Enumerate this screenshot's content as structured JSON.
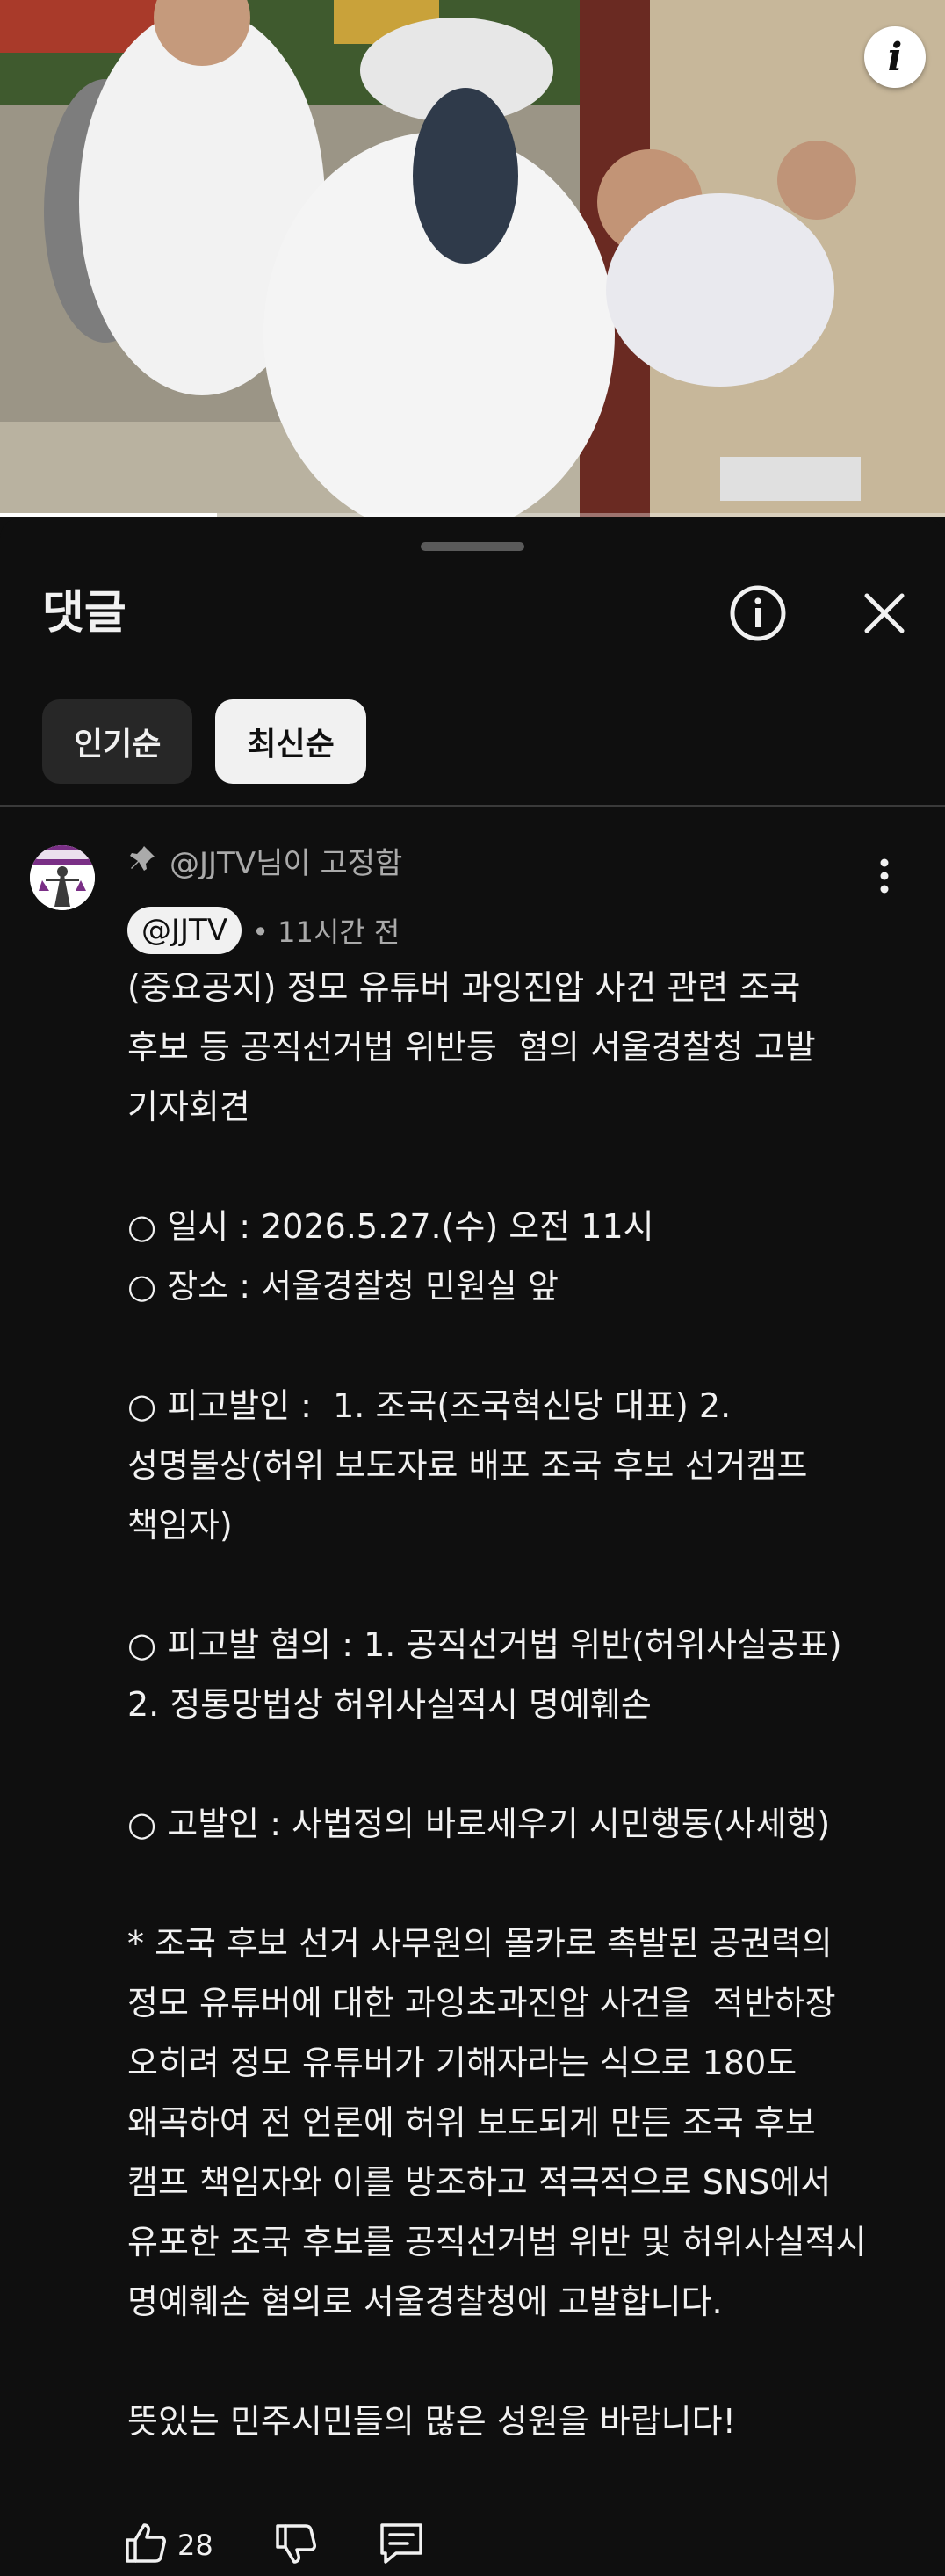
{
  "video": {
    "info_icon": "info-i-icon",
    "progress_fraction": 0.23
  },
  "sheet": {
    "title": "댓글",
    "info_icon": "info-circle-icon",
    "close_icon": "close-x-icon"
  },
  "sort_chips": [
    {
      "label": "인기순",
      "selected": false
    },
    {
      "label": "최신순",
      "selected": true
    }
  ],
  "comment": {
    "pinned_label": "@JJTV님이 고정함",
    "pin_icon": "pin-icon",
    "author": "@JJTV",
    "time": "• 11시간 전",
    "more_icon": "more-vertical-icon",
    "lines": [
      "(중요공지) 정모 유튜버 과잉진압 사건 관련 조국",
      "후보 등 공직선거법 위반등  혐의 서울경찰청 고발",
      "기자회견",
      "",
      "○ 일시 : 2026.5.27.(수) 오전 11시",
      "○ 장소 : 서울경찰청 민원실 앞",
      "",
      "○ 피고발인 :  1. 조국(조국혁신당 대표) 2.",
      "성명불상(허위 보도자료 배포 조국 후보 선거캠프",
      "책임자)",
      "",
      "○ 피고발 혐의 : 1. 공직선거법 위반(허위사실공표)",
      "2. 정통망법상 허위사실적시 명예훼손",
      "",
      "○ 고발인 : 사법정의 바로세우기 시민행동(사세행)",
      "",
      "* 조국 후보 선거 사무원의 몰카로 촉발된 공권력의",
      "정모 유튜버에 대한 과잉초과진압 사건을  적반하장",
      "오히려 정모 유튜버가 기해자라는 식으로 180도",
      "왜곡하여 전 언론에 허위 보도되게 만든 조국 후보",
      "캠프 책임자와 이를 방조하고 적극적으로 SNS에서",
      "유포한 조국 후보를 공직선거법 위반 및 허위사실적시",
      "명예훼손 혐의로 서울경찰청에 고발합니다.",
      "",
      "뜻있는 민주시민들의 많은 성원을 바랍니다!"
    ],
    "likes": "28",
    "like_icon": "thumbs-up-icon",
    "dislike_icon": "thumbs-down-icon",
    "reply_icon": "reply-comment-icon"
  }
}
